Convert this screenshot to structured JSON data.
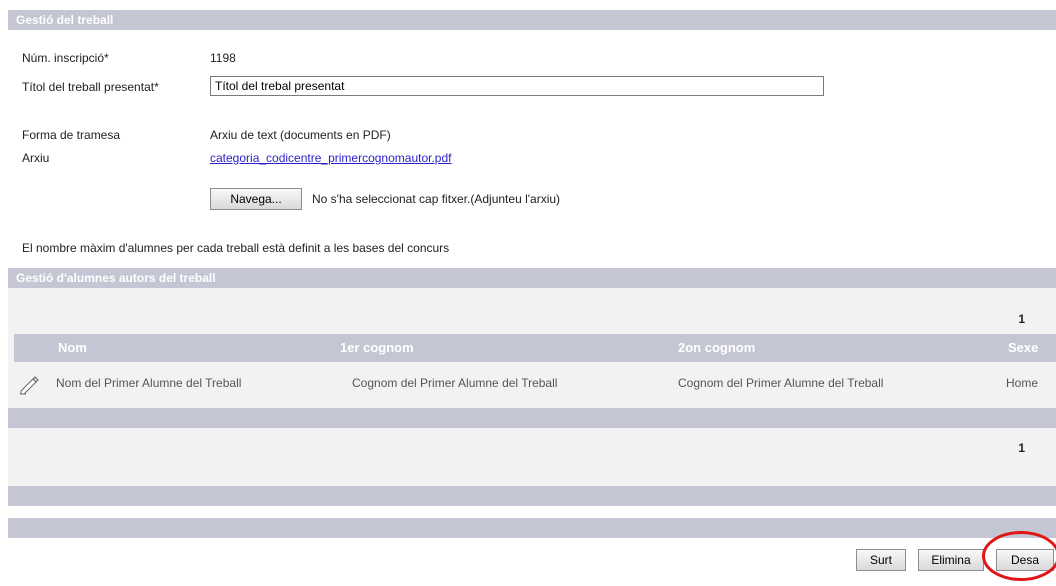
{
  "section_work": {
    "title": "Gestió del treball"
  },
  "form": {
    "inscription_label": "Núm. inscripció*",
    "inscription_value": "1198",
    "title_label": "Títol del treball presentat*",
    "title_value": "Títol del trebal presentat",
    "shipping_label": "Forma de tramesa",
    "shipping_value": "Arxiu de text (documents en PDF)",
    "file_label": "Arxiu",
    "file_link": "categoria_codicentre_primercognomautor.pdf",
    "browse_button": "Navega...",
    "no_file_text": "No s'ha seleccionat cap fitxer.(Adjunteu l'arxiu)",
    "note": "El nombre màxim d'alumnes per cada treball està definit a les bases del concurs"
  },
  "section_students": {
    "title": "Gestió d'alumnes autors del treball"
  },
  "table": {
    "page_top": "1",
    "columns": [
      "Nom",
      "1er cognom",
      "2on cognom",
      "Sexe"
    ],
    "rows": [
      {
        "icon": "edit-pencil-icon",
        "name": "Nom del Primer Alumne del Treball",
        "first_surname": "Cognom del Primer Alumne del Treball",
        "second_surname": "Cognom del Primer Alumne del Treball",
        "sex": "Home"
      }
    ],
    "page_bottom": "1"
  },
  "actions": {
    "exit": "Surt",
    "delete": "Elimina",
    "save": "Desa"
  },
  "colors": {
    "bar": "#c4c6d4",
    "panel": "#f2f2f2",
    "link": "#2a1fc8",
    "highlight": "#e01515"
  }
}
